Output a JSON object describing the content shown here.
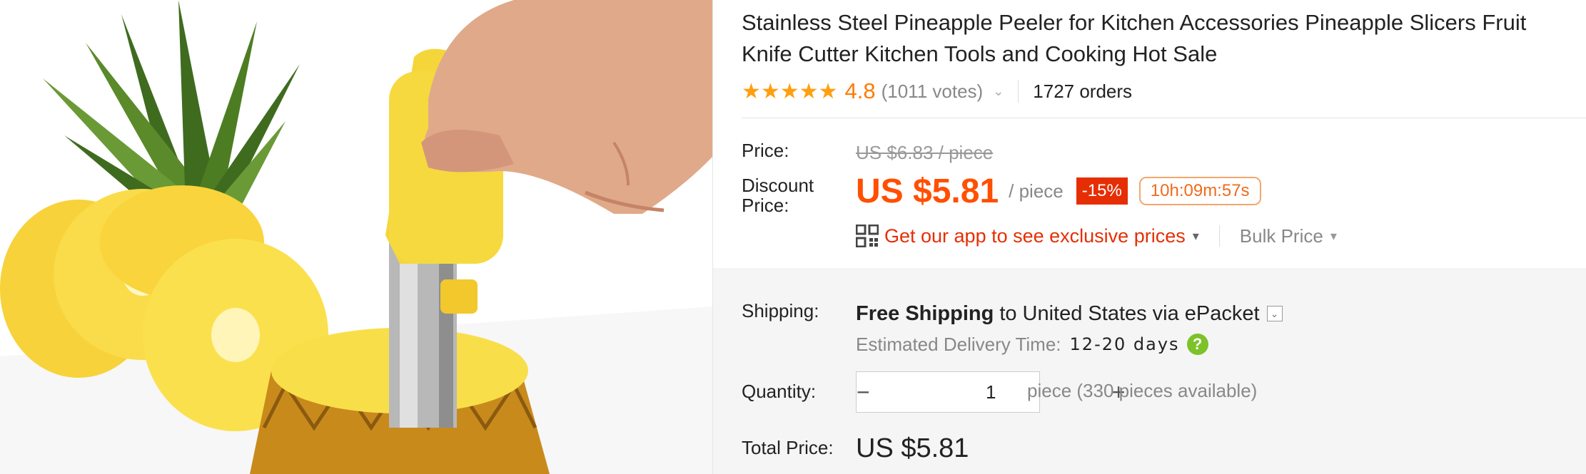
{
  "product": {
    "title": "Stainless Steel Pineapple Peeler for Kitchen Accessories Pineapple Slicers Fruit Knife Cutter Kitchen Tools and Cooking Hot Sale",
    "image_alt": "Pineapple peeler being pressed into a pineapple"
  },
  "rating": {
    "stars": "★★★★★",
    "score": "4.8",
    "votes": "(1011 votes)",
    "chevron": "⌄",
    "orders": "1727 orders"
  },
  "price": {
    "label": "Price:",
    "original": "US $6.83 / piece",
    "discount_label_line1": "Discount",
    "discount_label_line2": "Price:",
    "current": "US $5.81",
    "unit": "/ piece",
    "discount_badge": "-15%",
    "timer": "10h:09m:57s",
    "app_promo": "Get our app to see exclusive prices",
    "app_caret": "▾",
    "bulk": "Bulk Price",
    "bulk_caret": "▾"
  },
  "shipping": {
    "label": "Shipping:",
    "free": "Free Shipping",
    "to": "to",
    "country": "United States",
    "via": "via",
    "method": "ePacket",
    "dropdown": "⌄",
    "est_label": "Estimated Delivery Time:",
    "est_days": "12-20 days",
    "help": "?"
  },
  "quantity": {
    "label": "Quantity:",
    "minus": "−",
    "value": "1",
    "plus": "+",
    "available": "piece (330 pieces available)"
  },
  "total": {
    "label": "Total Price:",
    "value": "US $5.81"
  },
  "colors": {
    "accent_orange": "#ff4f00",
    "discount_red": "#e62e04",
    "star": "#ff9f10",
    "help_green": "#7cc229"
  }
}
